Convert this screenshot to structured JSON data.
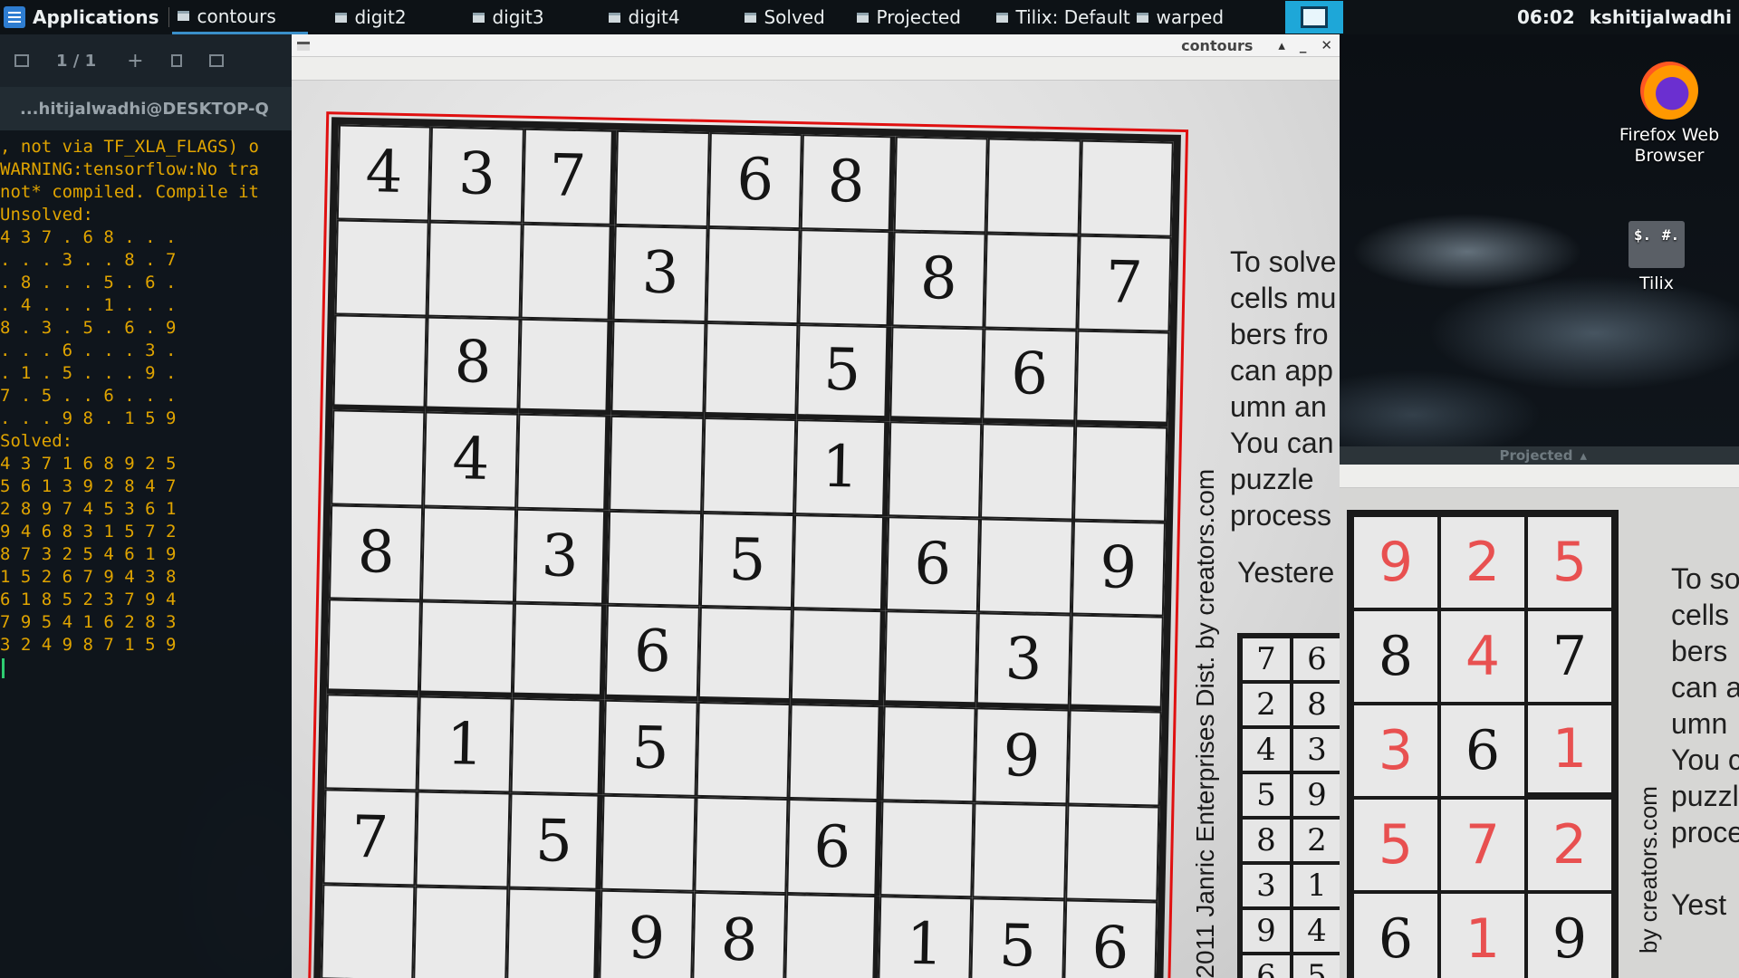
{
  "taskbar": {
    "apps_label": "Applications",
    "tasks": [
      {
        "label": "contours"
      },
      {
        "label": "digit2"
      },
      {
        "label": "digit3"
      },
      {
        "label": "digit4"
      },
      {
        "label": "Solved"
      },
      {
        "label": "Projected"
      },
      {
        "label": "Tilix: Default"
      },
      {
        "label": "warped"
      }
    ],
    "clock": "06:02",
    "username": "kshitijalwadhi"
  },
  "desktop": {
    "icons": [
      {
        "label": "Firefox Web Browser"
      },
      {
        "label": "Tilix",
        "glyph_left": "$.",
        "glyph_right": "#."
      }
    ]
  },
  "terminal": {
    "page_indicator": "1 / 1",
    "title": "...hitijalwadhi@DESKTOP-Q",
    "output": ", not via TF_XLA_FLAGS) o\nWARNING:tensorflow:No tra\nnot* compiled. Compile it\nUnsolved:\n4 3 7 . 6 8 . . .\n. . . 3 . . 8 . 7\n. 8 . . . 5 . 6 .\n. 4 . . . 1 . . .\n8 . 3 . 5 . 6 . 9\n. . . 6 . . . 3 .\n. 1 . 5 . . . 9 .\n7 . 5 . . 6 . . .\n. . . 9 8 . 1 5 9\nSolved:\n4 3 7 1 6 8 9 2 5\n5 6 1 3 9 2 8 4 7\n2 8 9 7 4 5 3 6 1\n9 4 6 8 3 1 5 7 2\n8 7 3 2 5 4 6 1 9\n1 5 2 6 7 9 4 3 8\n6 1 8 5 2 3 7 9 4\n7 9 5 4 1 6 2 8 3\n3 2 4 9 8 7 1 5 9"
  },
  "contours_window": {
    "title": "contours",
    "grid": [
      [
        "4",
        "3",
        "7",
        "",
        "6",
        "8",
        "",
        "",
        ""
      ],
      [
        "",
        "",
        "",
        "3",
        "",
        "",
        "8",
        "",
        "7"
      ],
      [
        "",
        "8",
        "",
        "",
        "",
        "5",
        "",
        "6",
        ""
      ],
      [
        "",
        "4",
        "",
        "",
        "",
        "1",
        "",
        "",
        ""
      ],
      [
        "8",
        "",
        "3",
        "",
        "5",
        "",
        "6",
        "",
        "9"
      ],
      [
        "",
        "",
        "",
        "6",
        "",
        "",
        "",
        "3",
        ""
      ],
      [
        "",
        "1",
        "",
        "5",
        "",
        "",
        "",
        "9",
        ""
      ],
      [
        "7",
        "",
        "5",
        "",
        "",
        "6",
        "",
        "",
        ""
      ],
      [
        "",
        "",
        "",
        "9",
        "8",
        "",
        "1",
        "5",
        "6"
      ]
    ],
    "credit": "© 2011 Janric Enterprises Dist. by creators.com",
    "side_text": "To solve\ncells mu\nbers fro\ncan app\numn an\nYou can\npuzzle \nprocess",
    "yesterday_label": "Yestere",
    "mini_grid": [
      "7",
      "6",
      "2",
      "8",
      "4",
      "3",
      "5",
      "9",
      "8",
      "2",
      "3",
      "1",
      "9",
      "4",
      "6",
      "5"
    ]
  },
  "projected_window": {
    "title": "Projected",
    "cells": [
      {
        "value": "9",
        "kind": "solved"
      },
      {
        "value": "2",
        "kind": "solved"
      },
      {
        "value": "5",
        "kind": "solved"
      },
      {
        "value": "8",
        "kind": "printed"
      },
      {
        "value": "4",
        "kind": "solved"
      },
      {
        "value": "7",
        "kind": "printed"
      },
      {
        "value": "3",
        "kind": "solved"
      },
      {
        "value": "6",
        "kind": "printed"
      },
      {
        "value": "1",
        "kind": "solved"
      },
      {
        "value": "5",
        "kind": "solved"
      },
      {
        "value": "7",
        "kind": "solved"
      },
      {
        "value": "2",
        "kind": "solved"
      },
      {
        "value": "6",
        "kind": "printed"
      },
      {
        "value": "1",
        "kind": "solved"
      },
      {
        "value": "9",
        "kind": "printed"
      }
    ],
    "side_text": "To so\ncells \nbers \ncan a\numn \nYou c\npuzzl\nproce\n\nYest",
    "credit": "by creators.com"
  },
  "colors": {
    "taskbar_bg": "#0d1216",
    "accent": "#1ea7d8",
    "terminal_text": "#e0a400",
    "contour_red": "#e01010",
    "solved_digit": "#e85050"
  }
}
